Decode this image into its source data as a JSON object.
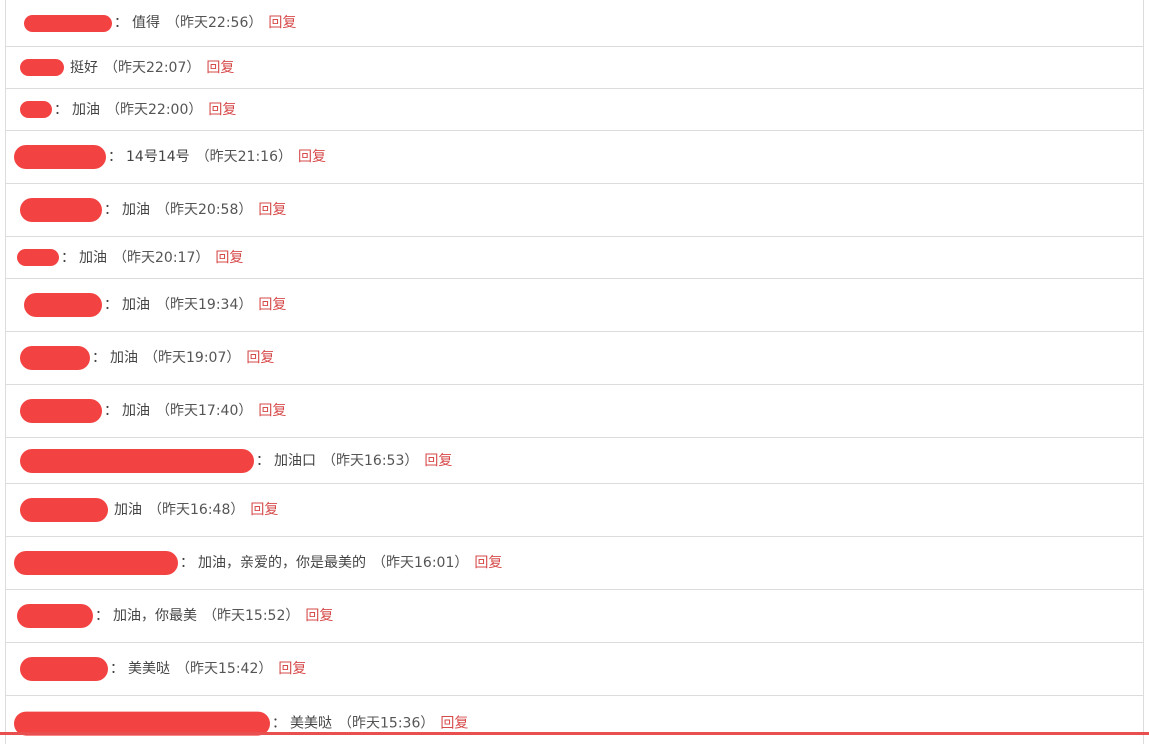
{
  "comments": [
    {
      "message": "值得",
      "time": "（昨天22:56）",
      "reply": "回复"
    },
    {
      "message": "挺好",
      "time": "（昨天22:07）",
      "reply": "回复"
    },
    {
      "message": "加油",
      "time": "（昨天22:00）",
      "reply": "回复"
    },
    {
      "message": "14号14号",
      "time": "（昨天21:16）",
      "reply": "回复"
    },
    {
      "message": "加油",
      "time": "（昨天20:58）",
      "reply": "回复"
    },
    {
      "message": "加油",
      "time": "（昨天20:17）",
      "reply": "回复"
    },
    {
      "message": "加油",
      "time": "（昨天19:34）",
      "reply": "回复"
    },
    {
      "message": "加油",
      "time": "（昨天19:07）",
      "reply": "回复"
    },
    {
      "message": "加油",
      "time": "（昨天17:40）",
      "reply": "回复"
    },
    {
      "message": "加油口",
      "time": "（昨天16:53）",
      "reply": "回复"
    },
    {
      "message": "加油",
      "time": "（昨天16:48）",
      "reply": "回复"
    },
    {
      "message": "加油，亲爱的，你是最美的",
      "time": "（昨天16:01）",
      "reply": "回复"
    },
    {
      "message": "加油，你最美",
      "time": "（昨天15:52）",
      "reply": "回复"
    },
    {
      "message": "美美哒",
      "time": "（昨天15:42）",
      "reply": "回复"
    },
    {
      "message": "美美哒",
      "time": "（昨天15:36）",
      "reply": "回复"
    }
  ],
  "colors": {
    "redaction": "#f23a3a",
    "reply_link": "#d74a4a",
    "divider": "#dcdcdc"
  }
}
